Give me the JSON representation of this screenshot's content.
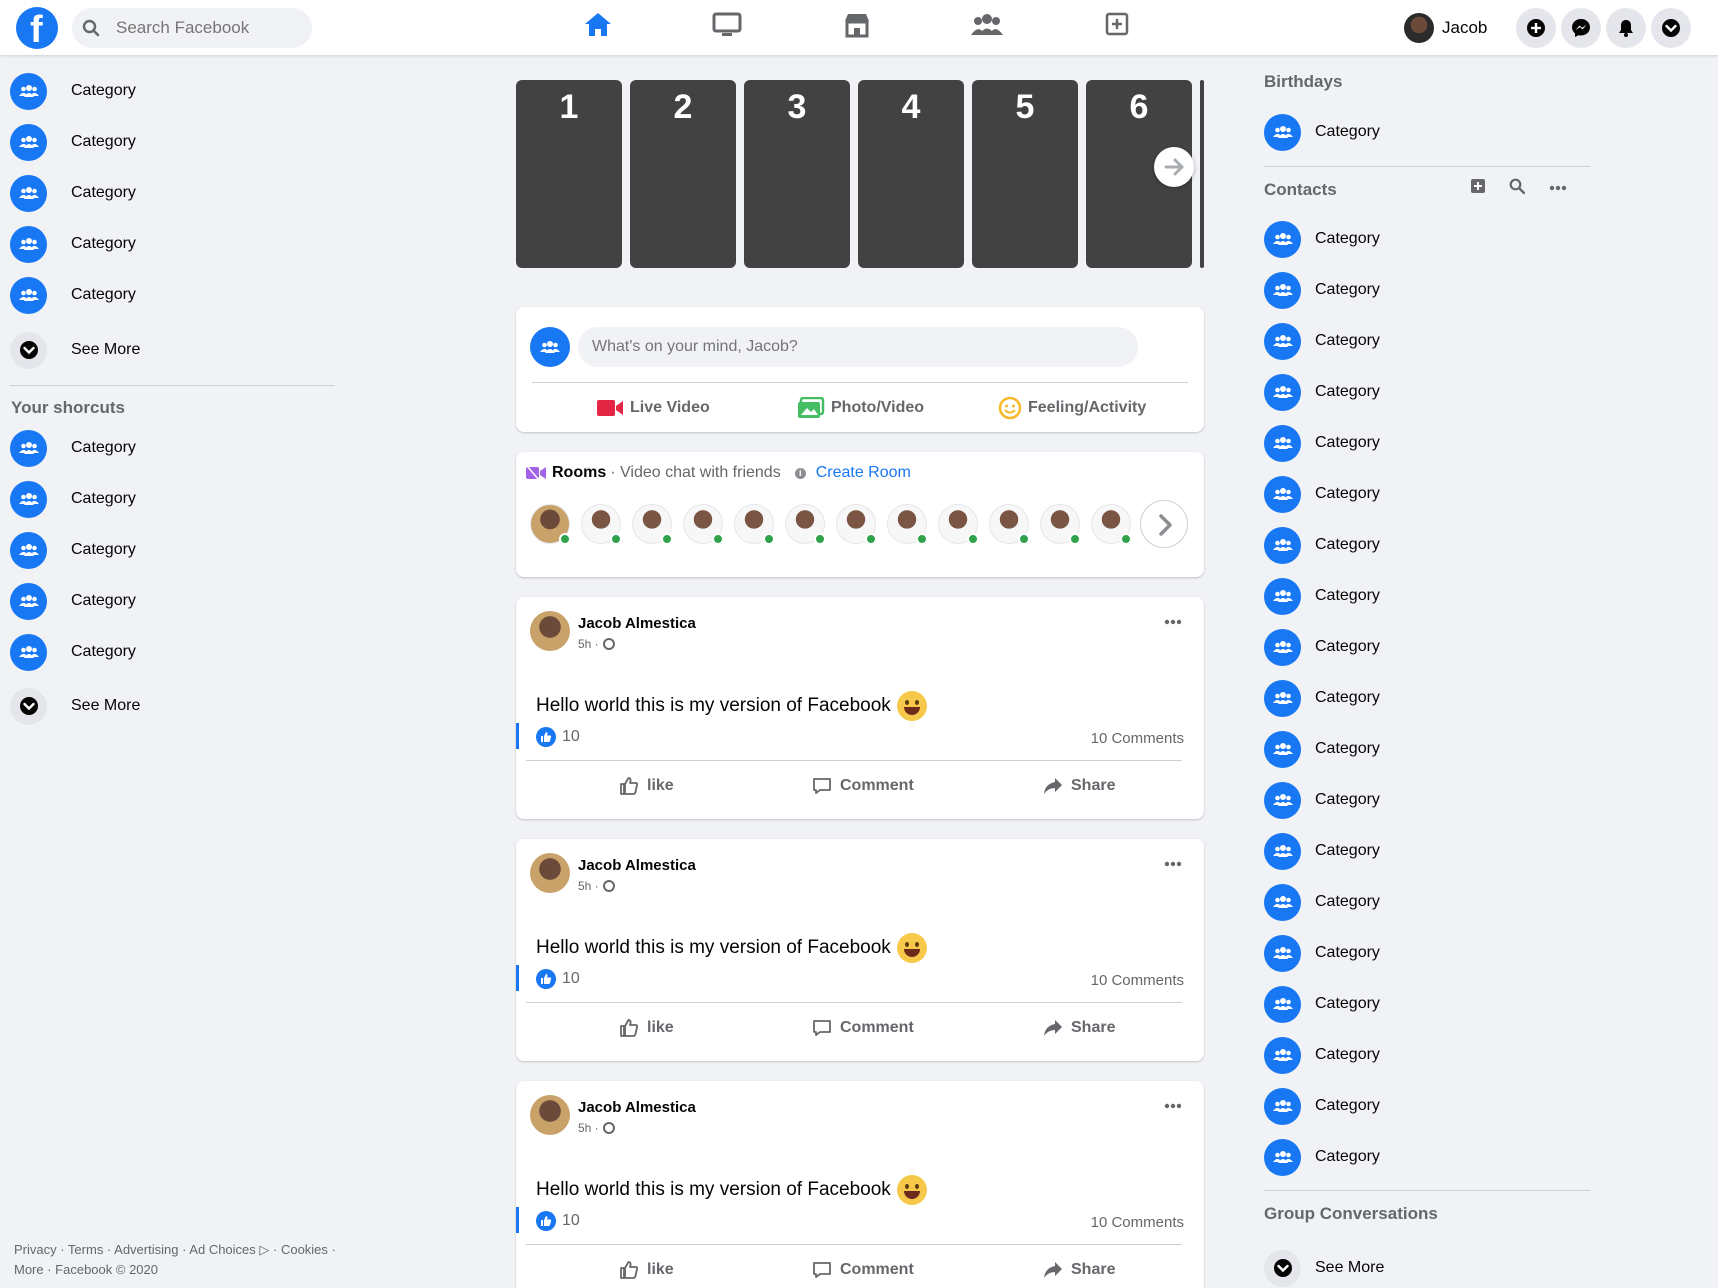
{
  "topbar": {
    "logo_letter": "f",
    "search_placeholder": "Search Facebook",
    "nav_icons": [
      "home-icon",
      "watch-icon",
      "marketplace-icon",
      "groups-icon",
      "gaming-icon"
    ],
    "profile_name": "Jacob",
    "action_icons": [
      "plus-icon",
      "messenger-icon",
      "bell-icon",
      "caret-down-icon"
    ],
    "accent_color": "#1877f2"
  },
  "left_sidebar": {
    "items": [
      "Category",
      "Category",
      "Category",
      "Category",
      "Category"
    ],
    "see_more": "See More",
    "shortcuts_title": "Your shorcuts",
    "shortcuts": [
      "Category",
      "Category",
      "Category",
      "Category",
      "Category"
    ],
    "shortcuts_see_more": "See More",
    "footer_line1": "Privacy · Terms · Advertising · Ad Choices ▷ · Cookies ·",
    "footer_line2": "More · Facebook © 2020"
  },
  "stories": [
    "1",
    "2",
    "3",
    "4",
    "5",
    "6"
  ],
  "composer": {
    "placeholder": "What's on your mind, Jacob?",
    "live_video": "Live Video",
    "photo_video": "Photo/Video",
    "feeling": "Feeling/Activity"
  },
  "rooms": {
    "title": "Rooms",
    "subtitle": "· Video chat with friends",
    "create": "Create Room",
    "avatar_count": 12
  },
  "posts": [
    {
      "author": "Jacob Almestica",
      "time": "5h ·",
      "text": "Hello world this is my version of Facebook",
      "likes": "10",
      "comments": "10 Comments",
      "like_label": "like",
      "comment_label": "Comment",
      "share_label": "Share"
    },
    {
      "author": "Jacob Almestica",
      "time": "5h ·",
      "text": "Hello world this is my version of Facebook",
      "likes": "10",
      "comments": "10 Comments",
      "like_label": "like",
      "comment_label": "Comment",
      "share_label": "Share"
    },
    {
      "author": "Jacob Almestica",
      "time": "5h ·",
      "text": "Hello world this is my version of Facebook",
      "likes": "10",
      "comments": "10 Comments",
      "like_label": "like",
      "comment_label": "Comment",
      "share_label": "Share"
    }
  ],
  "right_sidebar": {
    "birthdays_title": "Birthdays",
    "birthday_item": "Category",
    "contacts_title": "Contacts",
    "contacts": [
      "Category",
      "Category",
      "Category",
      "Category",
      "Category",
      "Category",
      "Category",
      "Category",
      "Category",
      "Category",
      "Category",
      "Category",
      "Category",
      "Category",
      "Category",
      "Category",
      "Category",
      "Category",
      "Category"
    ],
    "group_conversations_title": "Group Conversations",
    "see_more": "See More"
  }
}
